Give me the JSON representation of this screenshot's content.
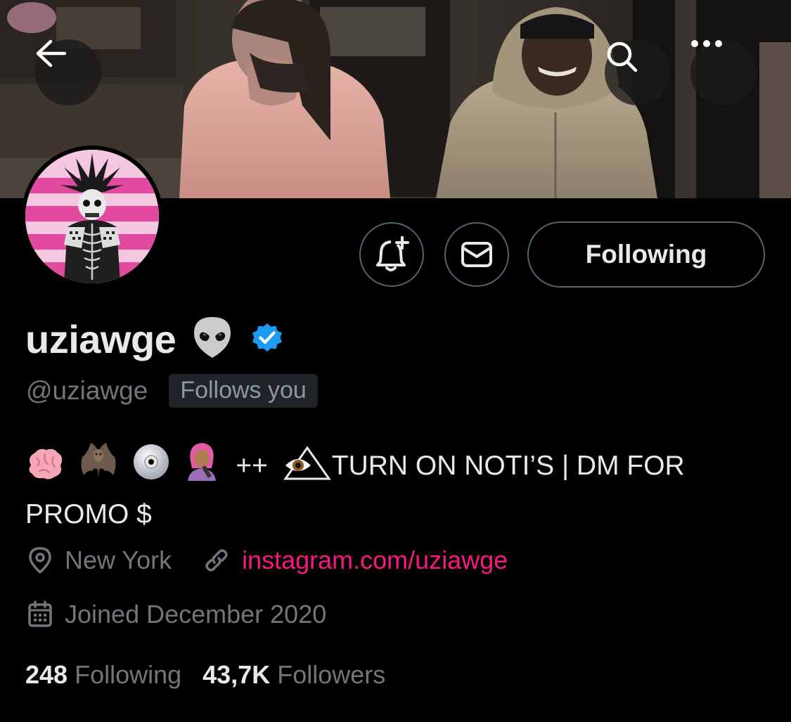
{
  "header": {
    "back_icon": "arrow-left-icon",
    "search_icon": "search-icon",
    "more_icon": "more-horizontal-icon"
  },
  "profile": {
    "display_name": "uziawge",
    "name_emoji": "alien-emoji",
    "verified": true,
    "verified_color": "#1d9bf0",
    "handle": "@uziawge",
    "follows_you_label": "Follows you"
  },
  "actions": {
    "notify_icon": "bell-plus-icon",
    "message_icon": "envelope-icon",
    "following_label": "Following"
  },
  "bio": {
    "emojis": [
      "brain-emoji",
      "bat-emoji",
      "dvd-emoji",
      "singer-emoji"
    ],
    "plus_text": "++",
    "eye_triangle": "eye-triangle-emoji",
    "text": "TURN ON NOTI’S | DM FOR PROMO $"
  },
  "meta": {
    "location": "New York",
    "website": "instagram.com/uziawge",
    "joined": "Joined December 2020"
  },
  "stats": {
    "following_count": "248",
    "following_label": "Following",
    "followers_count": "43,7K",
    "followers_label": "Followers"
  },
  "colors": {
    "background": "#000000",
    "text_primary": "#e7e9ea",
    "text_secondary": "#71767b",
    "link": "#f91880",
    "border": "#536471"
  }
}
